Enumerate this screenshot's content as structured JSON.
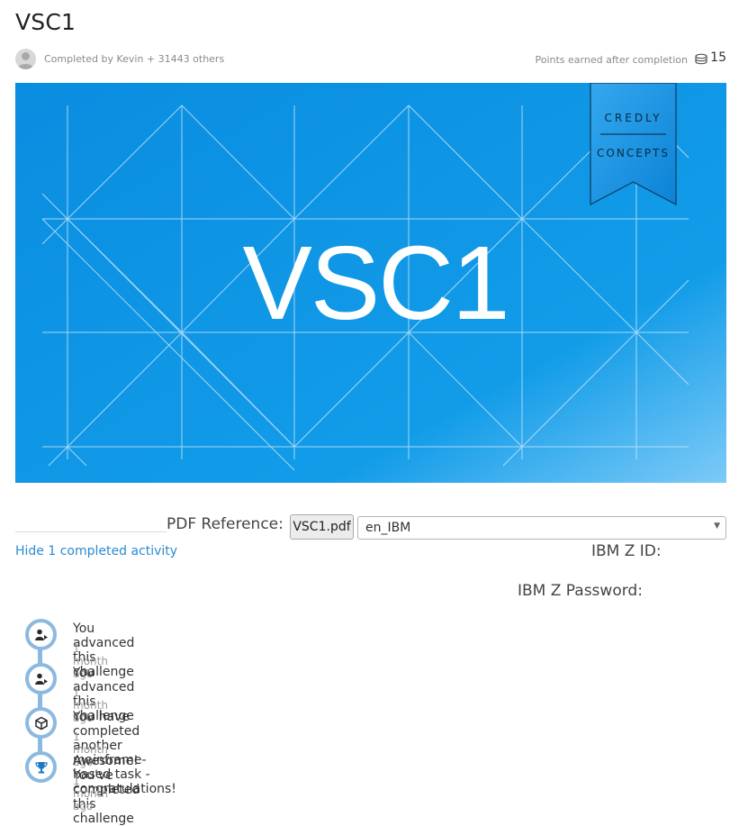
{
  "challenge": {
    "title": "VSC1",
    "completed_by": "Completed by Kevin + 31443 others",
    "points_label": "Points earned after completion",
    "points_value": "15"
  },
  "banner": {
    "main_text": "VSC1",
    "ribbon_line1": "CREDLY",
    "ribbon_line2": "CONCEPTS",
    "colors": {
      "bg_top": "#0a8fe0",
      "bg_corner": "#7ccaf7",
      "lines": "#bfe3fb"
    }
  },
  "reference": {
    "label": "PDF Reference:",
    "pdf_button": "VSC1.pdf",
    "language_selected": "en_IBM"
  },
  "credentials": {
    "id_label": "IBM Z ID:",
    "password_label": "IBM Z Password:"
  },
  "activity": {
    "hide_link": "Hide 1 completed activity",
    "items": [
      {
        "icon": "person-advance-icon",
        "text": "You advanced this challenge",
        "time": "1 month ago"
      },
      {
        "icon": "person-advance-icon",
        "text": "You advanced this challenge",
        "time": "1 month ago"
      },
      {
        "icon": "cube-icon",
        "text": "You have completed another mainframe-based task - congratulations!",
        "time": "1 month ago"
      },
      {
        "icon": "trophy-icon",
        "text": "Awesome! You've completed this challenge",
        "time": "1 month ago"
      }
    ]
  },
  "colors": {
    "link": "#2a8bd0",
    "timeline": "#8bb9e0"
  }
}
